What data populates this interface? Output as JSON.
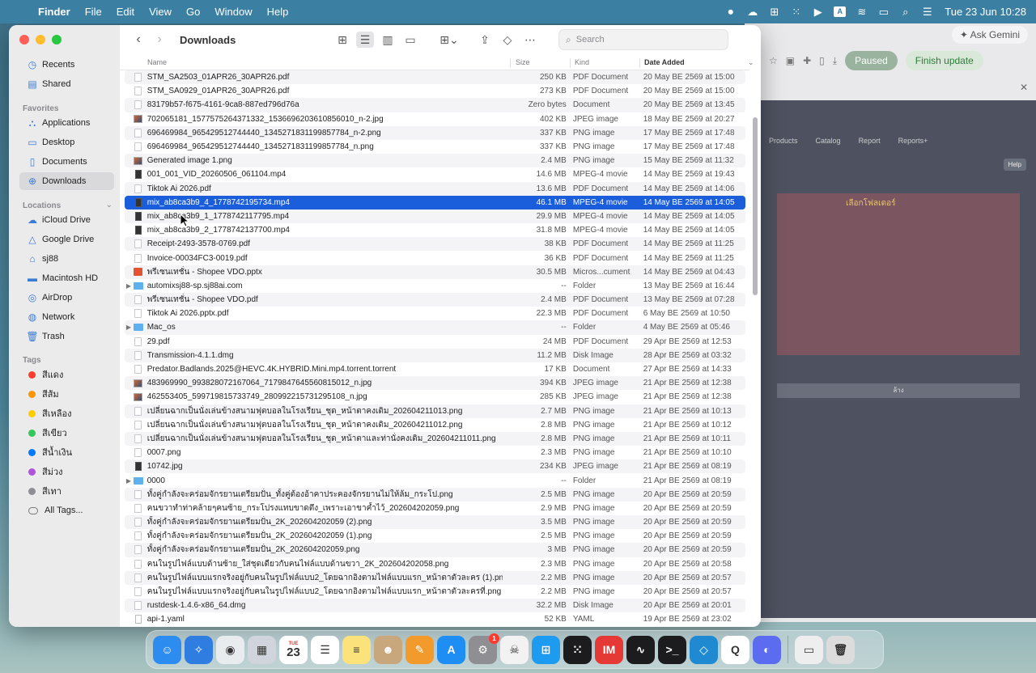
{
  "menubar": {
    "app": "Finder",
    "items": [
      "File",
      "Edit",
      "View",
      "Go",
      "Window",
      "Help"
    ],
    "clock": "Tue 23 Jun  10:28",
    "tray_icons": [
      "record-icon",
      "cloud-icon",
      "grid-icon",
      "dots-grid-icon",
      "play-icon",
      "keyboard-a-icon",
      "wifi-icon",
      "battery-icon",
      "search-icon",
      "control-center-icon"
    ],
    "input_letter": "A"
  },
  "background_app": {
    "gemini": "Ask Gemini",
    "paused": "Paused",
    "finish": "Finish update",
    "nav": [
      "Products",
      "Catalog",
      "Report",
      "Reports+"
    ],
    "help": "Help",
    "pick_folder": "เลือกโฟลเดอร์",
    "bar_text": "ล้าง"
  },
  "window": {
    "title": "Downloads",
    "search_placeholder": "Search"
  },
  "sidebar": {
    "favorites_label": "Favorites",
    "locations_label": "Locations",
    "tags_label": "Tags",
    "top": [
      {
        "label": "Recents",
        "icon": "clock-icon"
      },
      {
        "label": "Shared",
        "icon": "shared-folder-icon"
      }
    ],
    "favorites": [
      {
        "label": "Applications",
        "icon": "applications-icon"
      },
      {
        "label": "Desktop",
        "icon": "desktop-icon"
      },
      {
        "label": "Documents",
        "icon": "document-icon"
      },
      {
        "label": "Downloads",
        "icon": "downloads-icon"
      }
    ],
    "locations": [
      {
        "label": "iCloud Drive",
        "icon": "cloud-icon"
      },
      {
        "label": "Google Drive",
        "icon": "google-drive-icon"
      },
      {
        "label": "sj88",
        "icon": "home-icon"
      },
      {
        "label": "Macintosh HD",
        "icon": "disk-icon"
      },
      {
        "label": "AirDrop",
        "icon": "airdrop-icon"
      },
      {
        "label": "Network",
        "icon": "network-icon"
      },
      {
        "label": "Trash",
        "icon": "trash-icon"
      }
    ],
    "tags": [
      {
        "label": "สีแดง",
        "color": "#ff3b30"
      },
      {
        "label": "สีส้ม",
        "color": "#ff9500"
      },
      {
        "label": "สีเหลือง",
        "color": "#ffcc00"
      },
      {
        "label": "สีเขียว",
        "color": "#34c759"
      },
      {
        "label": "สีน้ำเงิน",
        "color": "#007aff"
      },
      {
        "label": "สีม่วง",
        "color": "#af52de"
      },
      {
        "label": "สีเทา",
        "color": "#8e8e93"
      },
      {
        "label": "All Tags...",
        "color": ""
      }
    ]
  },
  "columns": {
    "name": "Name",
    "size": "Size",
    "kind": "Kind",
    "date": "Date Added"
  },
  "files": [
    {
      "name": "STM_SA2503_01APR26_30APR26.pdf",
      "size": "250 KB",
      "kind": "PDF Document",
      "date": "20 May BE 2569 at 15:00",
      "type": "doc"
    },
    {
      "name": "STM_SA0929_01APR26_30APR26.pdf",
      "size": "273 KB",
      "kind": "PDF Document",
      "date": "20 May BE 2569 at 15:00",
      "type": "doc"
    },
    {
      "name": "83179b57-f675-4161-9ca8-887ed796d76a",
      "size": "Zero bytes",
      "kind": "Document",
      "date": "20 May BE 2569 at 13:45",
      "type": "doc"
    },
    {
      "name": "702065181_1577575264371332_1536696203610856010_n-2.jpg",
      "size": "402 KB",
      "kind": "JPEG image",
      "date": "18 May BE 2569 at 20:27",
      "type": "img"
    },
    {
      "name": "696469984_965429512744440_1345271831199857784_n-2.png",
      "size": "337 KB",
      "kind": "PNG image",
      "date": "17 May BE 2569 at 17:48",
      "type": "doc"
    },
    {
      "name": "696469984_965429512744440_1345271831199857784_n.png",
      "size": "337 KB",
      "kind": "PNG image",
      "date": "17 May BE 2569 at 17:48",
      "type": "doc"
    },
    {
      "name": "Generated image 1.png",
      "size": "2.4 MB",
      "kind": "PNG image",
      "date": "15 May BE 2569 at 11:32",
      "type": "img"
    },
    {
      "name": "001_001_VID_20260506_061104.mp4",
      "size": "14.6 MB",
      "kind": "MPEG-4 movie",
      "date": "14 May BE 2569 at 19:43",
      "type": "vid"
    },
    {
      "name": "Tiktok Ai 2026.pdf",
      "size": "13.6 MB",
      "kind": "PDF Document",
      "date": "14 May BE 2569 at 14:06",
      "type": "doc"
    },
    {
      "name": "mix_ab8ca3b9_4_1778742195734.mp4",
      "size": "46.1 MB",
      "kind": "MPEG-4 movie",
      "date": "14 May BE 2569 at 14:05",
      "type": "vid",
      "selected": true
    },
    {
      "name": "mix_ab8ca3b9_1_1778742117795.mp4",
      "size": "29.9 MB",
      "kind": "MPEG-4 movie",
      "date": "14 May BE 2569 at 14:05",
      "type": "vid"
    },
    {
      "name": "mix_ab8ca3b9_2_1778742137700.mp4",
      "size": "31.8 MB",
      "kind": "MPEG-4 movie",
      "date": "14 May BE 2569 at 14:05",
      "type": "vid"
    },
    {
      "name": "Receipt-2493-3578-0769.pdf",
      "size": "38 KB",
      "kind": "PDF Document",
      "date": "14 May BE 2569 at 11:25",
      "type": "doc"
    },
    {
      "name": "Invoice-00034FC3-0019.pdf",
      "size": "36 KB",
      "kind": "PDF Document",
      "date": "14 May BE 2569 at 11:25",
      "type": "doc"
    },
    {
      "name": "พรีเซนเทชั่น - Shopee VDO.pptx",
      "size": "30.5 MB",
      "kind": "Micros...cument",
      "date": "14 May BE 2569 at 04:43",
      "type": "ppt"
    },
    {
      "name": "automixsj88-sp.sj88ai.com",
      "size": "--",
      "kind": "Folder",
      "date": "13 May BE 2569 at 16:44",
      "type": "folder"
    },
    {
      "name": "พรีเซนเทชั่น - Shopee VDO.pdf",
      "size": "2.4 MB",
      "kind": "PDF Document",
      "date": "13 May BE 2569 at 07:28",
      "type": "doc"
    },
    {
      "name": "Tiktok Ai 2026.pptx.pdf",
      "size": "22.3 MB",
      "kind": "PDF Document",
      "date": "6 May BE 2569 at 10:50",
      "type": "doc"
    },
    {
      "name": "Mac_os",
      "size": "--",
      "kind": "Folder",
      "date": "4 May BE 2569 at 05:46",
      "type": "folder"
    },
    {
      "name": "29.pdf",
      "size": "24 MB",
      "kind": "PDF Document",
      "date": "29 Apr BE 2569 at 12:53",
      "type": "doc"
    },
    {
      "name": "Transmission-4.1.1.dmg",
      "size": "11.2 MB",
      "kind": "Disk Image",
      "date": "28 Apr BE 2569 at 03:32",
      "type": "doc"
    },
    {
      "name": "Predator.Badlands.2025@HEVC.4K.HYBRID.Mini.mp4.torrent.torrent",
      "size": "17 KB",
      "kind": "Document",
      "date": "27 Apr BE 2569 at 14:33",
      "type": "doc"
    },
    {
      "name": "483969990_993828072167064_7179847645560815012_n.jpg",
      "size": "394 KB",
      "kind": "JPEG image",
      "date": "21 Apr BE 2569 at 12:38",
      "type": "img"
    },
    {
      "name": "462553405_599719815733749_280992215731295108_n.jpg",
      "size": "285 KB",
      "kind": "JPEG image",
      "date": "21 Apr BE 2569 at 12:38",
      "type": "img"
    },
    {
      "name": "เปลี่ยนฉากเป็นนั่งเล่นข้างสนามฟุตบอลในโรงเรียน_ชุด_หน้าตาคงเดิม_202604211013.png",
      "size": "2.7 MB",
      "kind": "PNG image",
      "date": "21 Apr BE 2569 at 10:13",
      "type": "doc"
    },
    {
      "name": "เปลี่ยนฉากเป็นนั่งเล่นข้างสนามฟุตบอลในโรงเรียน_ชุด_หน้าตาคงเดิม_202604211012.png",
      "size": "2.8 MB",
      "kind": "PNG image",
      "date": "21 Apr BE 2569 at 10:12",
      "type": "doc"
    },
    {
      "name": "เปลี่ยนฉากเป็นนั่งเล่นข้างสนามฟุตบอลในโรงเรียน_ชุด_หน้าตาและท่านั่งคงเดิม_202604211011.png",
      "size": "2.8 MB",
      "kind": "PNG image",
      "date": "21 Apr BE 2569 at 10:11",
      "type": "doc"
    },
    {
      "name": "0007.png",
      "size": "2.3 MB",
      "kind": "PNG image",
      "date": "21 Apr BE 2569 at 10:10",
      "type": "doc"
    },
    {
      "name": "10742.jpg",
      "size": "234 KB",
      "kind": "JPEG image",
      "date": "21 Apr BE 2569 at 08:19",
      "type": "vid"
    },
    {
      "name": "0000",
      "size": "--",
      "kind": "Folder",
      "date": "21 Apr BE 2569 at 08:19",
      "type": "folder"
    },
    {
      "name": "ทั้งคู่กำลังจะคร่อมจักรยานเตรียมปั่น_ทั้งคู่ต้องอ้าคาประคองจักรยานไม่ให้ล้ม_กระโป.png",
      "size": "2.5 MB",
      "kind": "PNG image",
      "date": "20 Apr BE 2569 at 20:59",
      "type": "doc"
    },
    {
      "name": "คนขวาทำท่าคล้ายๆคนซ้าย_กระโปรงแทบขาดตึง_เพราะเอาขาค้ำไว้_202604202059.png",
      "size": "2.9 MB",
      "kind": "PNG image",
      "date": "20 Apr BE 2569 at 20:59",
      "type": "doc"
    },
    {
      "name": "ทั้งคู่กำลังจะคร่อมจักรยานเตรียมปั่น_2K_202604202059 (2).png",
      "size": "3.5 MB",
      "kind": "PNG image",
      "date": "20 Apr BE 2569 at 20:59",
      "type": "doc"
    },
    {
      "name": "ทั้งคู่กำลังจะคร่อมจักรยานเตรียมปั่น_2K_202604202059 (1).png",
      "size": "2.5 MB",
      "kind": "PNG image",
      "date": "20 Apr BE 2569 at 20:59",
      "type": "doc"
    },
    {
      "name": "ทั้งคู่กำลังจะคร่อมจักรยานเตรียมปั่น_2K_202604202059.png",
      "size": "3 MB",
      "kind": "PNG image",
      "date": "20 Apr BE 2569 at 20:59",
      "type": "doc"
    },
    {
      "name": "คนในรูปไฟล์แบบด้านซ้าย_ใส่ชุดเดียวกับคนไฟล์แบบด้านขวา_2K_202604202058.png",
      "size": "2.3 MB",
      "kind": "PNG image",
      "date": "20 Apr BE 2569 at 20:58",
      "type": "doc"
    },
    {
      "name": "คนในรูปไฟล์แบบแรกจริงอยู่กับคนในรูปไฟล์แบบ2_โดยฉากอิงตามไฟล์แบบแรก_หน้าตาตัวละคร (1).png",
      "size": "2.2 MB",
      "kind": "PNG image",
      "date": "20 Apr BE 2569 at 20:57",
      "type": "doc"
    },
    {
      "name": "คนในรูปไฟล์แบบแรกจริงอยู่กับคนในรูปไฟล์แบบ2_โดยฉากอิงตามไฟล์แบบแรก_หน้าตาตัวละครที่.png",
      "size": "2.2 MB",
      "kind": "PNG image",
      "date": "20 Apr BE 2569 at 20:57",
      "type": "doc"
    },
    {
      "name": "rustdesk-1.4.6-x86_64.dmg",
      "size": "32.2 MB",
      "kind": "Disk Image",
      "date": "20 Apr BE 2569 at 20:01",
      "type": "doc"
    },
    {
      "name": "api-1.yaml",
      "size": "52 KB",
      "kind": "YAML",
      "date": "19 Apr BE 2569 at 23:02",
      "type": "yaml"
    }
  ],
  "dock": [
    {
      "name": "finder",
      "icon": "finder-icon",
      "color": "#2d8cf0",
      "glyph": "☺"
    },
    {
      "name": "safari",
      "icon": "safari-icon",
      "color": "#2f7de1",
      "glyph": "✧"
    },
    {
      "name": "chrome",
      "icon": "chrome-icon",
      "color": "#e9ecef",
      "glyph": "◉"
    },
    {
      "name": "launchpad",
      "icon": "launchpad-icon",
      "color": "#d0d4dc",
      "glyph": "▦"
    },
    {
      "name": "calendar",
      "icon": "calendar-icon",
      "color": "#ffffff",
      "glyph": "23",
      "sub": "TUE"
    },
    {
      "name": "reminders",
      "icon": "reminders-icon",
      "color": "#ffffff",
      "glyph": "☰"
    },
    {
      "name": "notes",
      "icon": "notes-icon",
      "color": "#fbe27a",
      "glyph": "≡"
    },
    {
      "name": "contacts",
      "icon": "contacts-icon",
      "color": "#c8a77d",
      "glyph": "☻"
    },
    {
      "name": "pages",
      "icon": "pages-icon",
      "color": "#f39a2c",
      "glyph": "✎"
    },
    {
      "name": "app-store",
      "icon": "app-store-icon",
      "color": "#1e8ef5",
      "glyph": "A"
    },
    {
      "name": "system-settings",
      "icon": "gear-icon",
      "color": "#8e8e93",
      "glyph": "⚙",
      "badge": "1"
    },
    {
      "name": "app-avatar",
      "icon": "avatar-icon",
      "color": "#f2f2f2",
      "glyph": "☠"
    },
    {
      "name": "windows-app",
      "icon": "windows-icon",
      "color": "#1d9bf0",
      "glyph": "⊞"
    },
    {
      "name": "grid-app",
      "icon": "dots-grid-icon",
      "color": "#1c1c1e",
      "glyph": "⁙"
    },
    {
      "name": "im-app",
      "icon": "im-icon",
      "color": "#e53935",
      "glyph": "IM"
    },
    {
      "name": "activity-monitor",
      "icon": "activity-icon",
      "color": "#1c1c1e",
      "glyph": "∿"
    },
    {
      "name": "terminal",
      "icon": "terminal-icon",
      "color": "#1c1c1e",
      "glyph": ">_"
    },
    {
      "name": "vscode",
      "icon": "vscode-icon",
      "color": "#1f8ad2",
      "glyph": "◇"
    },
    {
      "name": "quicken",
      "icon": "q-icon",
      "color": "#ffffff",
      "glyph": "Q"
    },
    {
      "name": "chat-app",
      "icon": "chat-icon",
      "color": "#5b6cf0",
      "glyph": "◐"
    },
    {
      "name": "preview",
      "icon": "preview-icon",
      "color": "#eeeeee",
      "glyph": "▭"
    },
    {
      "name": "trash",
      "icon": "trash-icon",
      "color": "#dcdcdc",
      "glyph": "🗑"
    }
  ]
}
